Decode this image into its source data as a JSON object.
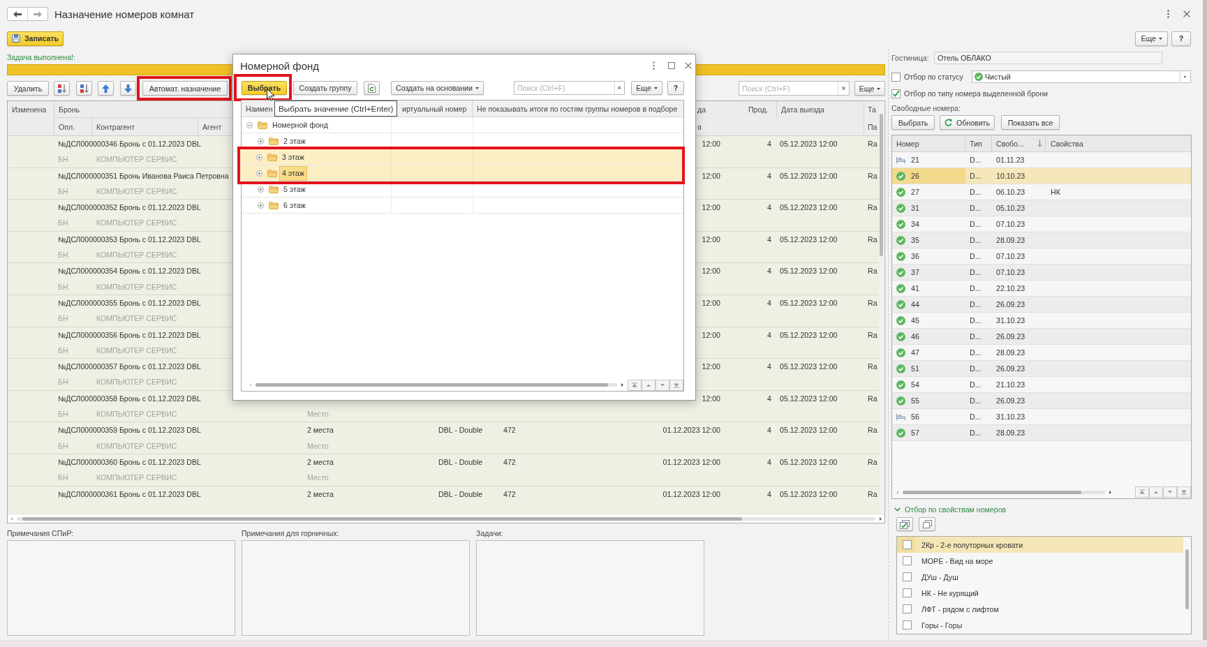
{
  "window": {
    "title": "Назначение номеров комнат"
  },
  "command_bar": {
    "save_button": "Записать",
    "more_button": "Еще",
    "help_button": "?"
  },
  "task_status": {
    "message": "Задача выполнена!:",
    "progress": {
      "level": 1
    }
  },
  "bookings_toolbar": {
    "delete_button": "Удалить",
    "auto_assign_button": {
      "label": "Автомат. назначение",
      "highlighted": true
    },
    "search": {
      "placeholder": "Поиск (Ctrl+F)"
    },
    "more_button": "Еще"
  },
  "bookings_table": {
    "header": {
      "changed": "Изменена",
      "booking": "Бронь",
      "column_9": "да",
      "nights": "Прод.",
      "departure": "Дата выезда",
      "column_12": "Та",
      "payment": "Опл.",
      "counterparty": "Контрагент",
      "agent": "Агент",
      "column_9_line_2": "я",
      "column_12_line_2": "Па"
    },
    "rows": [
      {
        "booking": "№ДСЛ000000346 Бронь с 01.12.2023 DBL",
        "payment": "БН",
        "counterparty": "КОМПЬЮТЕР СЕРВИС",
        "column_9": "12:00",
        "nights": "4",
        "departure": "05.12.2023 12:00",
        "column_12": "Ra"
      },
      {
        "booking": "№ДСЛ000000351 Бронь Иванова Раиса Петровна",
        "payment": "БН",
        "counterparty": "КОМПЬЮТЕР СЕРВИС",
        "column_9": "12:00",
        "nights": "4",
        "departure": "05.12.2023 12:00",
        "column_12": "Ra"
      },
      {
        "booking": "№ДСЛ000000352 Бронь с 01.12.2023 DBL",
        "payment": "БН",
        "counterparty": "КОМПЬЮТЕР СЕРВИС",
        "column_9": "12:00",
        "nights": "4",
        "departure": "05.12.2023 12:00",
        "column_12": "Ra"
      },
      {
        "booking": "№ДСЛ000000353 Бронь с 01.12.2023 DBL",
        "payment": "БН",
        "counterparty": "КОМПЬЮТЕР СЕРВИС",
        "column_9": "12:00",
        "nights": "4",
        "departure": "05.12.2023 12:00",
        "column_12": "Ra"
      },
      {
        "booking": "№ДСЛ000000354 Бронь с 01.12.2023 DBL",
        "payment": "БН",
        "counterparty": "КОМПЬЮТЕР СЕРВИС",
        "column_9": "12:00",
        "nights": "4",
        "departure": "05.12.2023 12:00",
        "column_12": "Ra"
      },
      {
        "booking": "№ДСЛ000000355 Бронь с 01.12.2023 DBL",
        "payment": "БН",
        "counterparty": "КОМПЬЮТЕР СЕРВИС",
        "column_9": "12:00",
        "nights": "4",
        "departure": "05.12.2023 12:00",
        "column_12": "Ra"
      },
      {
        "booking": "№ДСЛ000000356 Бронь с 01.12.2023 DBL",
        "payment": "БН",
        "counterparty": "КОМПЬЮТЕР СЕРВИС",
        "column_9": "12:00",
        "nights": "4",
        "departure": "05.12.2023 12:00",
        "column_12": "Ra"
      },
      {
        "booking": "№ДСЛ000000357 Бронь с 01.12.2023 DBL",
        "payment": "БН",
        "counterparty": "КОМПЬЮТЕР СЕРВИС",
        "column_9": "12:00",
        "nights": "4",
        "departure": "05.12.2023 12:00",
        "column_12": "Ra"
      },
      {
        "booking": "№ДСЛ000000358 Бронь с 01.12.2023 DBL",
        "payment": "БН",
        "counterparty": "КОМПЬЮТЕР СЕРВИС",
        "column_5_line_2": "Место",
        "column_9": "12:00",
        "nights": "4",
        "departure": "05.12.2023 12:00",
        "column_12": "Ra"
      },
      {
        "booking": "№ДСЛ000000359 Бронь с 01.12.2023 DBL",
        "payment": "БН",
        "counterparty": "КОМПЬЮТЕР СЕРВИС",
        "column_5": "2 места",
        "column_5_line_2": "Место",
        "column_7": "DBL - Double",
        "column_8": "472",
        "column_9": "01.12.2023 12:00",
        "nights": "4",
        "departure": "05.12.2023 12:00",
        "column_12": "Ra"
      },
      {
        "booking": "№ДСЛ000000360 Бронь с 01.12.2023 DBL",
        "payment": "БН",
        "counterparty": "КОМПЬЮТЕР СЕРВИС",
        "column_5": "2 места",
        "column_5_line_2": "Место",
        "column_7": "DBL - Double",
        "column_8": "472",
        "column_9": "01.12.2023 12:00",
        "nights": "4",
        "departure": "05.12.2023 12:00",
        "column_12": "Ra"
      },
      {
        "booking": "№ДСЛ000000361 Бронь с 01.12.2023 DBL",
        "column_5": "2 места",
        "column_7": "DBL - Double",
        "column_8": "472",
        "column_9": "01.12.2023 12:00",
        "nights": "4",
        "departure": "05.12.2023 12:00",
        "column_12": "Ra"
      }
    ]
  },
  "dialog": {
    "title": "Номерной фонд",
    "select_button": {
      "label": "Выбрать",
      "highlighted": true
    },
    "create_group_button": "Создать группу",
    "create_based_on_button": "Создать на основании",
    "search": {
      "placeholder": "Поиск (Ctrl+F)"
    },
    "more_button": "Еще",
    "help_button": "?",
    "tooltip": "Выбрать значение (Ctrl+Enter)",
    "columns": [
      "Наимен",
      "иртуальный номер",
      "Не показывать итоги по гостям группы номеров в подборе"
    ],
    "tree": [
      {
        "label": "Номерной фонд",
        "expanded": true,
        "selected": false,
        "highlighted": false,
        "focused": false,
        "children": [
          {
            "label": "2 этаж",
            "expanded": false,
            "selected": false,
            "highlighted": false,
            "focused": false
          },
          {
            "label": "3 этаж",
            "expanded": false,
            "selected": true,
            "highlighted": true,
            "focused": false
          },
          {
            "label": "4 этаж",
            "expanded": false,
            "selected": true,
            "highlighted": true,
            "focused": true
          },
          {
            "label": "5 этаж",
            "expanded": false,
            "selected": false,
            "highlighted": false,
            "focused": false
          },
          {
            "label": "6 этаж",
            "expanded": false,
            "selected": false,
            "highlighted": false,
            "focused": false
          }
        ]
      }
    ]
  },
  "room_panel": {
    "hotel": {
      "label": "Гостиница:",
      "value": "Отель ОБЛАКО"
    },
    "status_filter": {
      "label": "Отбор по статусу",
      "checked": false,
      "value": "Чистый"
    },
    "type_filter": {
      "label": "Отбор по типу номера выделенной брони",
      "checked": true
    },
    "free_rooms_label": "Свободные номера:",
    "buttons": [
      {
        "kind": "plain",
        "label": "Выбрать"
      },
      {
        "kind": "refresh",
        "label": "Обновить"
      },
      {
        "kind": "plain",
        "label": "Показать все"
      }
    ],
    "rooms_table": {
      "columns": [
        {
          "title": "Номер",
          "sorted": false
        },
        {
          "title": "Тип",
          "sorted": false
        },
        {
          "title": "Свобо...",
          "sorted": true
        },
        {
          "title": "Свойства",
          "sorted": false
        }
      ],
      "rows": [
        {
          "kind": "bed",
          "number": "21",
          "type": "D...",
          "column_3": "01.11.23",
          "selected": false
        },
        {
          "kind": "check",
          "number": "26",
          "type": "D...",
          "column_3": "10.10.23",
          "selected": true
        },
        {
          "kind": "check",
          "number": "27",
          "type": "D...",
          "column_3": "06.10.23",
          "properties": "НК",
          "selected": false
        },
        {
          "kind": "check",
          "number": "31",
          "type": "D...",
          "column_3": "05.10.23",
          "selected": false
        },
        {
          "kind": "check",
          "number": "34",
          "type": "D...",
          "column_3": "07.10.23",
          "selected": false
        },
        {
          "kind": "check",
          "number": "35",
          "type": "D...",
          "column_3": "28.09.23",
          "selected": false
        },
        {
          "kind": "check",
          "number": "36",
          "type": "D...",
          "column_3": "07.10.23",
          "selected": false
        },
        {
          "kind": "check",
          "number": "37",
          "type": "D...",
          "column_3": "07.10.23",
          "selected": false
        },
        {
          "kind": "check",
          "number": "41",
          "type": "D...",
          "column_3": "22.10.23",
          "selected": false
        },
        {
          "kind": "check",
          "number": "44",
          "type": "D...",
          "column_3": "26.09.23",
          "selected": false
        },
        {
          "kind": "check",
          "number": "45",
          "type": "D...",
          "column_3": "31.10.23",
          "selected": false
        },
        {
          "kind": "check",
          "number": "46",
          "type": "D...",
          "column_3": "26.09.23",
          "selected": false
        },
        {
          "kind": "check",
          "number": "47",
          "type": "D...",
          "column_3": "28.09.23",
          "selected": false
        },
        {
          "kind": "check",
          "number": "51",
          "type": "D...",
          "column_3": "26.09.23",
          "selected": false
        },
        {
          "kind": "check",
          "number": "54",
          "type": "D...",
          "column_3": "21.10.23",
          "selected": false
        },
        {
          "kind": "check",
          "number": "55",
          "type": "D...",
          "column_3": "26.09.23",
          "selected": false
        },
        {
          "kind": "bed",
          "number": "56",
          "type": "D...",
          "column_3": "31.10.23",
          "selected": false
        },
        {
          "kind": "check",
          "number": "57",
          "type": "D...",
          "column_3": "28.09.23",
          "selected": false
        }
      ]
    },
    "properties_filter": {
      "title": "Отбор по свойствам номеров",
      "expanded": true,
      "items": [
        {
          "label": "2Кр - 2-е полуторных кровати",
          "checked": false,
          "selected": true
        },
        {
          "label": "МОРЕ - Вид на море",
          "checked": false,
          "selected": false
        },
        {
          "label": "ДУш - Душ",
          "checked": false,
          "selected": false
        },
        {
          "label": "НК - Не курящий",
          "checked": false,
          "selected": false
        },
        {
          "label": "ЛФТ - рядом с лифтом",
          "checked": false,
          "selected": false
        },
        {
          "label": "Горы - Горы",
          "checked": false,
          "selected": false
        }
      ]
    }
  },
  "notes": [
    {
      "label": "Примечания СПиР:"
    },
    {
      "label": "Примечания для горничных:"
    },
    {
      "label": "Задачи:"
    }
  ]
}
